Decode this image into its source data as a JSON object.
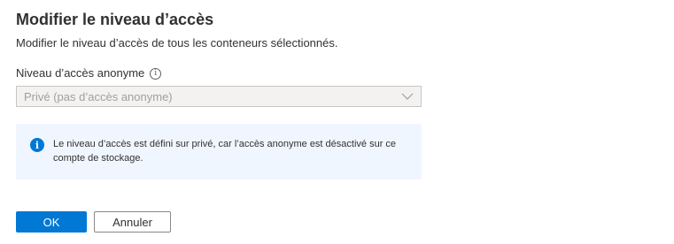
{
  "dialog": {
    "title": "Modifier le niveau d’accès",
    "subtitle": "Modifier le niveau d’accès de tous les conteneurs sélectionnés."
  },
  "field": {
    "label": "Niveau d’accès anonyme",
    "value": "Privé (pas d’accès anonyme)",
    "disabled": true
  },
  "info": {
    "icon": "info-icon",
    "message": "Le niveau d’accès est défini sur privé, car l’accès anonyme est désactivé sur ce compte de stockage."
  },
  "buttons": {
    "ok_label": "OK",
    "cancel_label": "Annuler"
  },
  "colors": {
    "primary": "#0078d4",
    "info_background": "#f0f6ff",
    "disabled_background": "#f3f2f1"
  }
}
